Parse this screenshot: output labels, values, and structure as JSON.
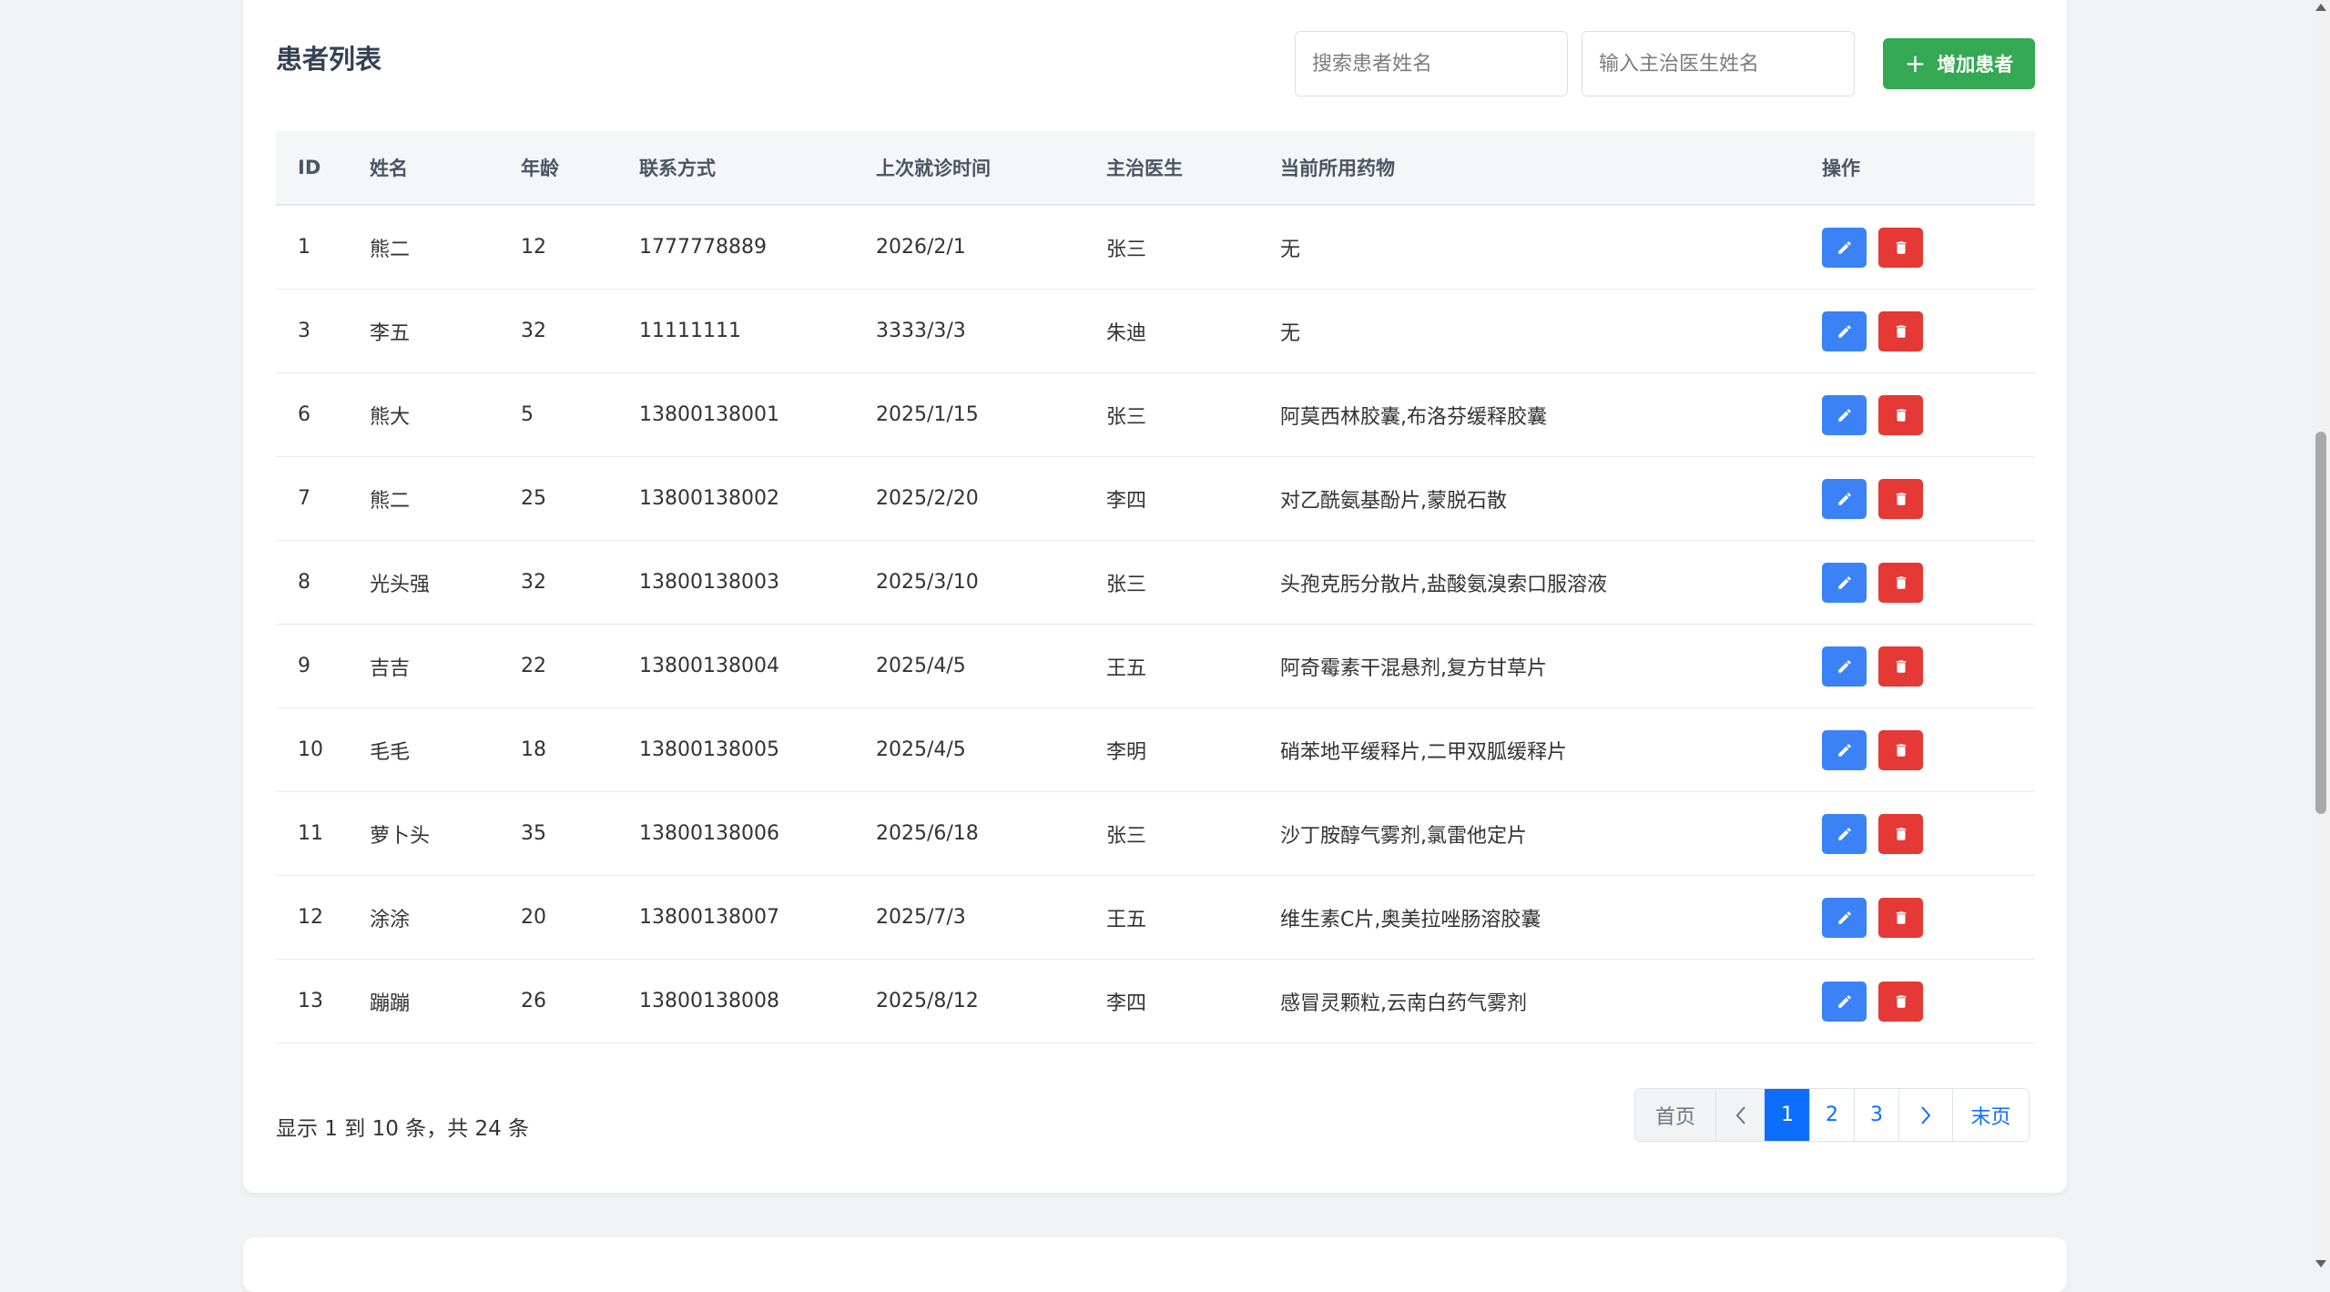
{
  "title": "患者列表",
  "search": {
    "patient_placeholder": "搜索患者姓名",
    "doctor_placeholder": "输入主治医生姓名"
  },
  "add_button": {
    "icon": "plus-icon",
    "label": "增加患者",
    "color": "#34a853"
  },
  "table": {
    "headers": [
      "ID",
      "姓名",
      "年龄",
      "联系方式",
      "上次就诊时间",
      "主治医生",
      "当前所用药物",
      "操作"
    ],
    "rows": [
      [
        "1",
        "熊二",
        "12",
        "1777778889",
        "2026/2/1",
        "张三",
        "无"
      ],
      [
        "3",
        "李五",
        "32",
        "11111111",
        "3333/3/3",
        "朱迪",
        "无"
      ],
      [
        "6",
        "熊大",
        "5",
        "13800138001",
        "2025/1/15",
        "张三",
        "阿莫西林胶囊,布洛芬缓释胶囊"
      ],
      [
        "7",
        "熊二",
        "25",
        "13800138002",
        "2025/2/20",
        "李四",
        "对乙酰氨基酚片,蒙脱石散"
      ],
      [
        "8",
        "光头强",
        "32",
        "13800138003",
        "2025/3/10",
        "张三",
        "头孢克肟分散片,盐酸氨溴索口服溶液"
      ],
      [
        "9",
        "吉吉",
        "22",
        "13800138004",
        "2025/4/5",
        "王五",
        "阿奇霉素干混悬剂,复方甘草片"
      ],
      [
        "10",
        "毛毛",
        "18",
        "13800138005",
        "2025/4/5",
        "李明",
        "硝苯地平缓释片,二甲双胍缓释片"
      ],
      [
        "11",
        "萝卜头",
        "35",
        "13800138006",
        "2025/6/18",
        "张三",
        "沙丁胺醇气雾剂,氯雷他定片"
      ],
      [
        "12",
        "涂涂",
        "20",
        "13800138007",
        "2025/7/3",
        "王五",
        "维生素C片,奥美拉唑肠溶胶囊"
      ],
      [
        "13",
        "蹦蹦",
        "26",
        "13800138008",
        "2025/8/12",
        "李四",
        "感冒灵颗粒,云南白药气雾剂"
      ]
    ],
    "action_icons": {
      "edit": "pencil-icon",
      "delete": "trash-icon"
    },
    "action_colors": {
      "edit": "#3b82f6",
      "delete": "#e53935"
    }
  },
  "footer": {
    "summary": "显示 1 到 10 条，共 24 条",
    "pagination": {
      "first": "首页",
      "prev": "‹",
      "pages": [
        "1",
        "2",
        "3"
      ],
      "current": "1",
      "next": "›",
      "last": "末页"
    }
  }
}
